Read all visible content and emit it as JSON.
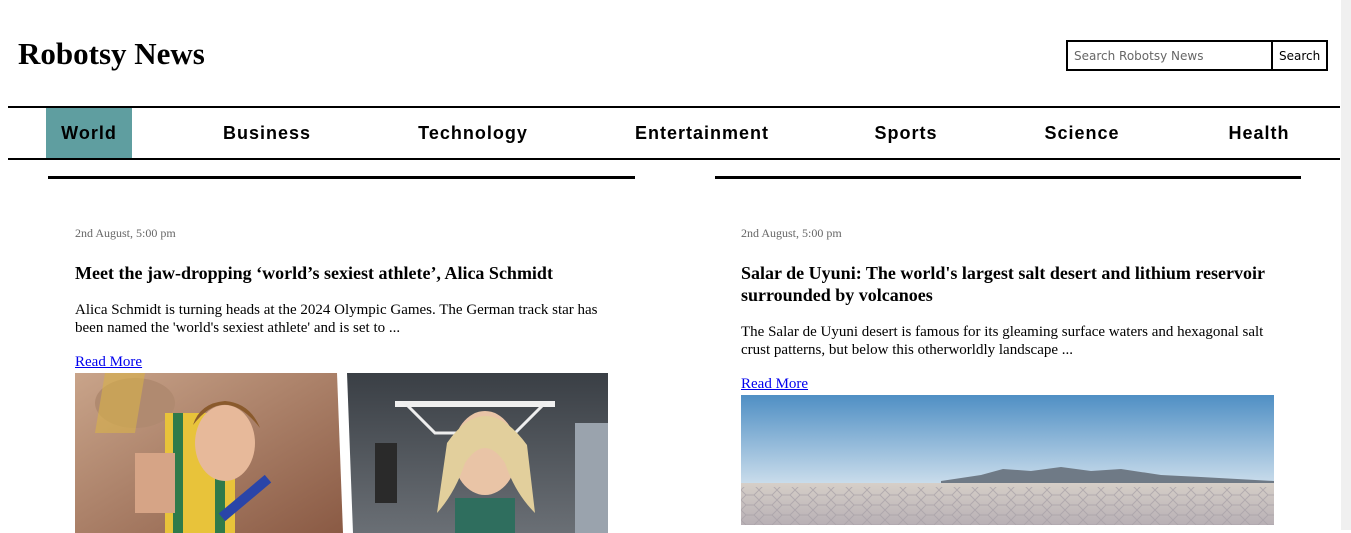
{
  "site": {
    "title": "Robotsy News"
  },
  "search": {
    "placeholder": "Search Robotsy News",
    "button_label": "Search"
  },
  "nav": {
    "items": [
      {
        "label": "World",
        "active": true
      },
      {
        "label": "Business"
      },
      {
        "label": "Technology"
      },
      {
        "label": "Entertainment"
      },
      {
        "label": "Sports"
      },
      {
        "label": "Science"
      },
      {
        "label": "Health"
      }
    ]
  },
  "articles": [
    {
      "date": "2nd August, 5:00 pm",
      "title": "Meet the jaw-dropping ‘world’s sexiest athlete’, Alica Schmidt",
      "excerpt": "Alica Schmidt is turning heads at the 2024 Olympic Games. The German track star has been named the 'world's sexiest athlete' and is set to ...",
      "read_more": "Read More"
    },
    {
      "date": "2nd August, 5:00 pm",
      "title": "Salar de Uyuni: The world's largest salt desert and lithium reservoir surrounded by volcanoes",
      "excerpt": "The Salar de Uyuni desert is famous for its gleaming surface waters and hexagonal salt crust patterns, but below this otherworldly landscape ...",
      "read_more": "Read More"
    }
  ],
  "colors": {
    "active_nav": "#5f9ea0",
    "link": "#0000ee"
  }
}
